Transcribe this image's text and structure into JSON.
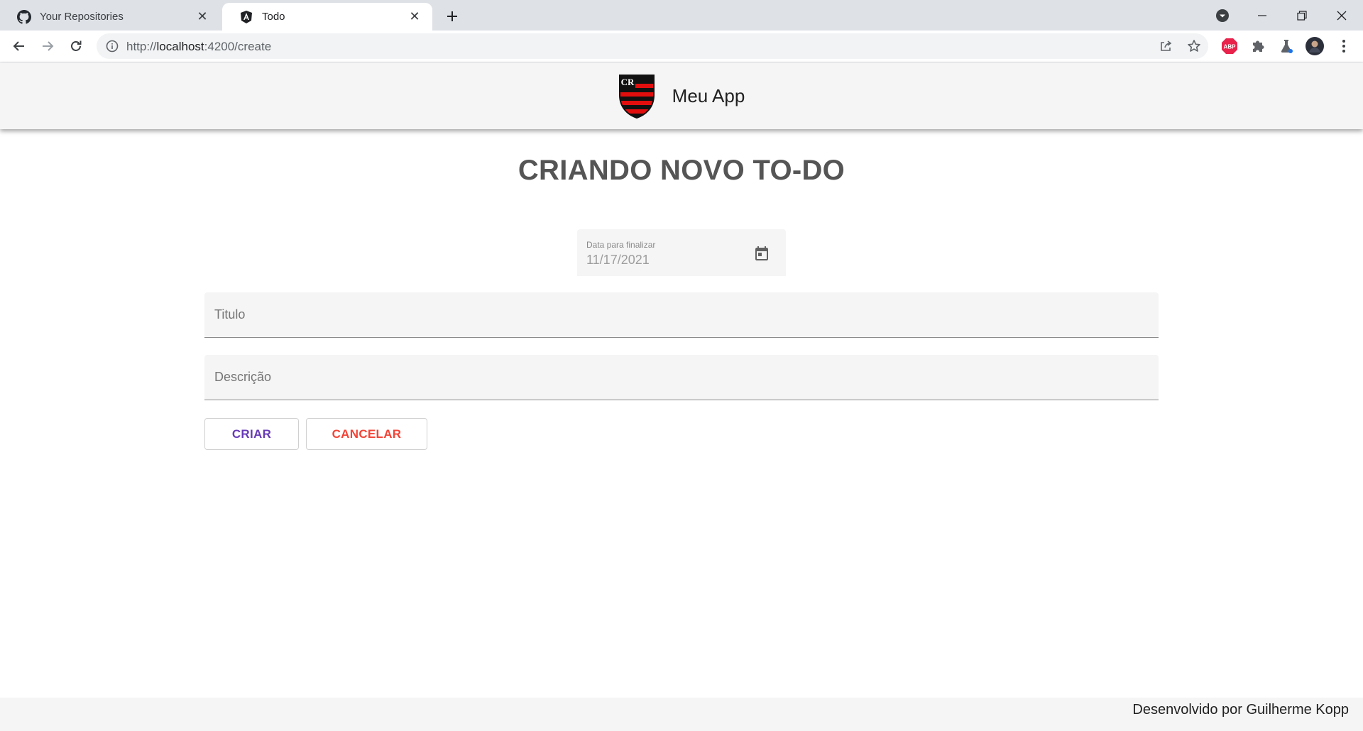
{
  "browser": {
    "tabs": [
      {
        "title": "Your Repositories",
        "icon": "github-icon",
        "active": false
      },
      {
        "title": "Todo",
        "icon": "angular-icon",
        "active": true
      }
    ],
    "url_prefix": "http://",
    "url_host": "localhost",
    "url_path": ":4200/create",
    "extensions": [
      "share-icon",
      "star-icon",
      "adblock-plus-icon",
      "puzzle-extension-icon",
      "labs-flask-icon",
      "profile-avatar",
      "more-menu-icon"
    ]
  },
  "app": {
    "title": "Meu App",
    "logo": "flamengo-crest-logo"
  },
  "form": {
    "heading": "CRIANDO NOVO TO-DO",
    "date_label": "Data para finalizar",
    "date_value": "11/17/2021",
    "title_placeholder": "Titulo",
    "description_placeholder": "Descrição",
    "create_label": "CRIAR",
    "cancel_label": "CANCELAR"
  },
  "footer": {
    "text": "Desenvolvido por Guilherme Kopp"
  },
  "colors": {
    "primary": "#673ab7",
    "warn": "#f44336",
    "header_bg": "#f5f5f5",
    "logo_red": "#e20e0e",
    "logo_black": "#111111"
  }
}
